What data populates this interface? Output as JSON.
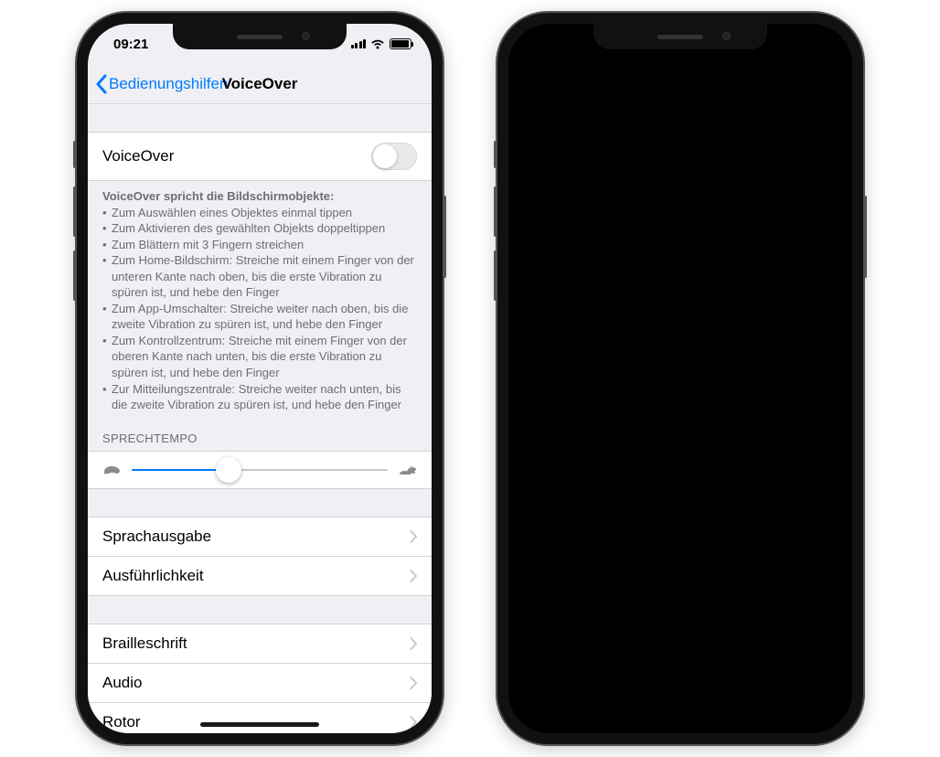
{
  "status": {
    "time": "09:21"
  },
  "nav": {
    "back": "Bedienungshilfen",
    "title": "VoiceOver"
  },
  "main": {
    "voiceover_label": "VoiceOver",
    "voiceover_on": false,
    "desc_header": "VoiceOver spricht die Bildschirmobjekte:",
    "desc_items": [
      "Zum Auswählen eines Objektes einmal tippen",
      "Zum Aktivieren des gewählten Objekts doppeltippen",
      "Zum Blättern mit 3 Fingern streichen",
      "Zum Home-Bildschirm: Streiche mit einem Finger von der unteren Kante nach oben, bis die erste Vibration zu spüren ist, und hebe den Finger",
      "Zum App-Umschalter: Streiche weiter nach oben, bis die zweite Vibration zu spüren ist, und hebe den Finger",
      "Zum Kontrollzentrum: Streiche mit einem Finger von der oberen Kante nach unten, bis die erste Vibration zu spüren ist, und hebe den Finger",
      "Zur Mitteilungszentrale: Streiche weiter nach unten, bis die zweite Vibration zu spüren ist, und hebe den Finger"
    ],
    "rate_header": "SPRECHTEMPO",
    "rate_percent": 38,
    "group1": [
      {
        "label": "Sprachausgabe"
      },
      {
        "label": "Ausführlichkeit"
      }
    ],
    "group2": [
      {
        "label": "Brailleschrift"
      },
      {
        "label": "Audio"
      },
      {
        "label": "Rotor"
      }
    ]
  }
}
